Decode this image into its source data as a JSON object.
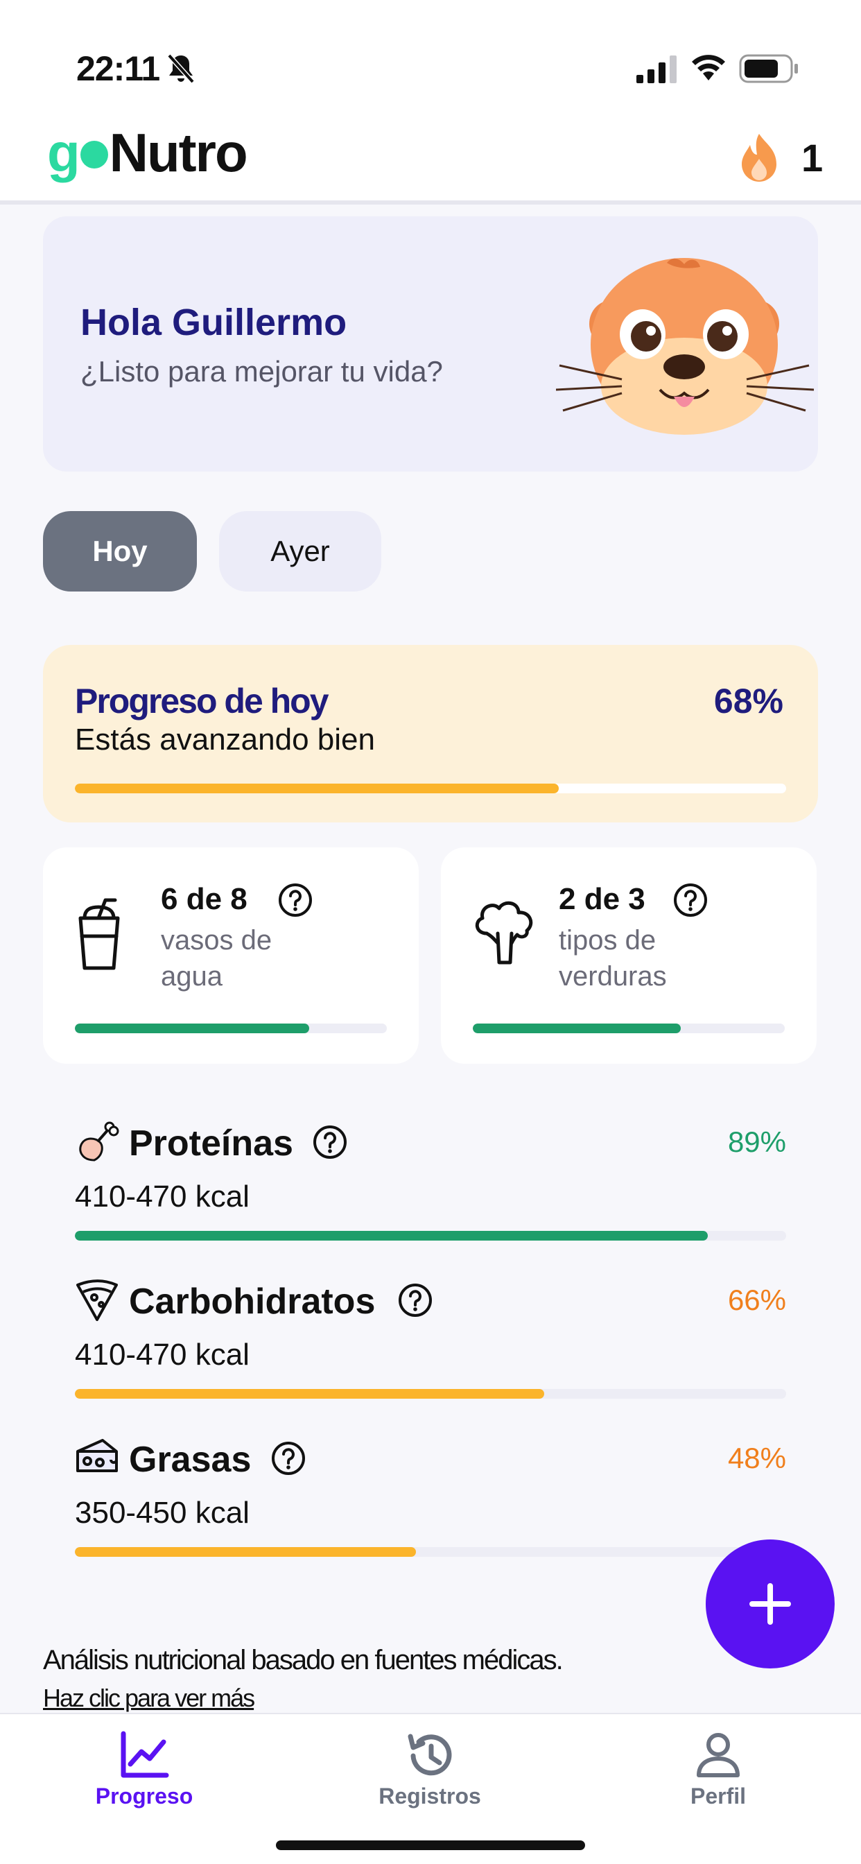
{
  "status_bar": {
    "time": "22:11"
  },
  "header": {
    "logo_prefix": "g",
    "logo_suffix": "Nutro",
    "streak_count": "1"
  },
  "greeting": {
    "title": "Hola Guillermo",
    "subtitle": "¿Listo para mejorar tu vida?"
  },
  "tabs": [
    {
      "label": "Hoy",
      "selected": true
    },
    {
      "label": "Ayer",
      "selected": false
    }
  ],
  "daily_progress": {
    "title": "Progreso de hoy",
    "percent_label": "68%",
    "percent": 68,
    "subtitle": "Estás avanzando bien"
  },
  "stats": [
    {
      "value": "6 de 8",
      "label": "vasos de agua",
      "fraction": 0.75,
      "icon": "water-glass-icon"
    },
    {
      "value": "2 de 3",
      "label": "tipos de verduras",
      "fraction": 0.667,
      "icon": "broccoli-icon"
    }
  ],
  "macros": [
    {
      "name": "Proteínas",
      "range": "410-470 kcal",
      "percent_label": "89%",
      "percent": 89,
      "icon": "drumstick-icon"
    },
    {
      "name": "Carbohidratos",
      "range": "410-470 kcal",
      "percent_label": "66%",
      "percent": 66,
      "icon": "pizza-icon"
    },
    {
      "name": "Grasas",
      "range": "350-450 kcal",
      "percent_label": "48%",
      "percent": 48,
      "icon": "cheese-icon"
    }
  ],
  "footer_note": {
    "text": "Análisis nutricional basado en fuentes médicas.",
    "link": "Haz clic para ver más"
  },
  "bottom_nav": [
    {
      "label": "Progreso",
      "active": true,
      "icon": "chart-line-icon"
    },
    {
      "label": "Registros",
      "active": false,
      "icon": "history-icon"
    },
    {
      "label": "Perfil",
      "active": false,
      "icon": "user-icon"
    }
  ],
  "colors": {
    "brand_green": "#2bd9a0",
    "navy": "#1f1c7d",
    "bar_green": "#1e9e6a",
    "bar_yellow": "#fbb42b",
    "percent_green": "#1e9e6a",
    "percent_orange": "#f07f1c",
    "fab_purple": "#5a12f2",
    "nav_active": "#5a12f2",
    "nav_inactive": "#6b7280"
  }
}
